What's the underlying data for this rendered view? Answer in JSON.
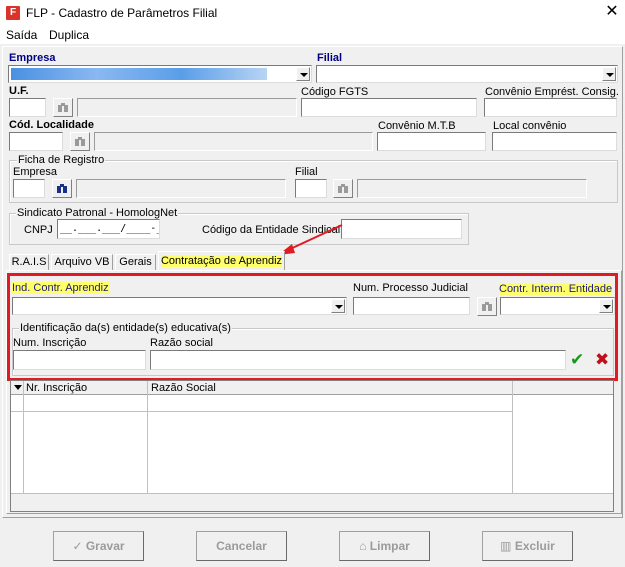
{
  "window": {
    "icon_letter": "F",
    "title": "FLP - Cadastro de Parâmetros Filial",
    "close_glyph": "✕"
  },
  "menu": {
    "items": [
      "Saída",
      "Duplica"
    ]
  },
  "form": {
    "empresa_label": "Empresa",
    "filial_label": "Filial",
    "uf_label": "U.F.",
    "codigo_fgts_label": "Código FGTS",
    "convenio_emprest_label": "Convênio Emprést. Consig.",
    "cod_localidade_label": "Cód. Localidade",
    "convenio_mtb_label": "Convênio M.T.B",
    "local_convenio_label": "Local convênio",
    "ficha_registro": {
      "title": "Ficha de Registro",
      "empresa_label": "Empresa",
      "filial_label": "Filial"
    },
    "sindicato": {
      "title": "Sindicato Patronal -  HomologNet",
      "cnpj_label": "CNPJ",
      "cnpj_mask": "__.___.___/____-__",
      "codigo_entidade_label": "Código da Entidade Sindical"
    }
  },
  "tabs": [
    "R.A.I.S",
    "Arquivo VB",
    "Gerais",
    "Contratação de Aprendiz"
  ],
  "aprendiz": {
    "ind_contr_label": "Ind. Contr. Aprendiz",
    "num_processo_label": "Num. Processo Judicial",
    "contr_interm_label": "Contr. Interm. Entidade",
    "identificacao_title": "Identificação da(s) entidade(s) educativa(s)",
    "num_inscricao_label": "Num. Inscrição",
    "razao_social_label": "Razão social",
    "confirm_glyph": "✔",
    "cancel_glyph": "✖"
  },
  "grid": {
    "columns": [
      "Nr. Inscrição",
      "Razão Social"
    ]
  },
  "buttons": {
    "gravar": "Gravar",
    "cancelar": "Cancelar",
    "limpar": "Limpar",
    "excluir": "Excluir"
  },
  "colors": {
    "highlight": "#ffff6a",
    "annotation_red": "#e01b24",
    "confirm_green": "#1a9a1a",
    "cancel_red": "#c0101a"
  }
}
